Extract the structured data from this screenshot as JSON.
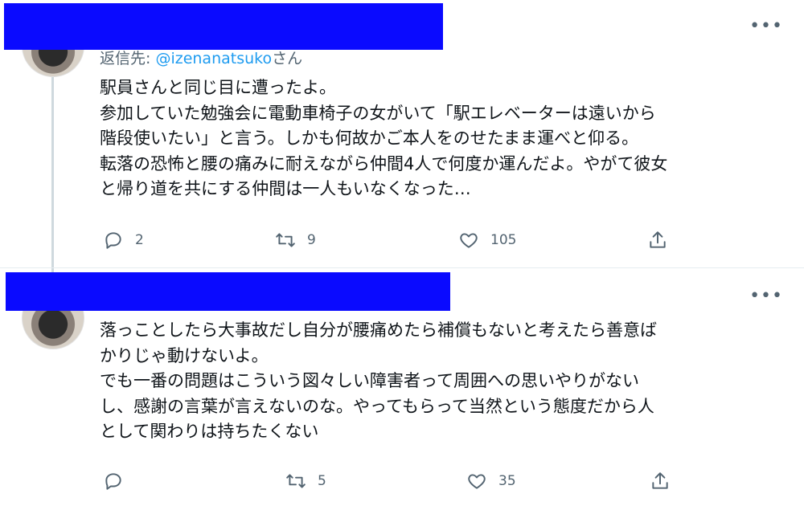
{
  "tweet1": {
    "reply_prefix": "返信先: ",
    "reply_handle": "@izenanatsuko",
    "reply_suffix": "さん",
    "more": "•••",
    "lines": [
      "駅員さんと同じ目に遭ったよ。",
      "参加していた勉強会に電動車椅子の女がいて「駅エレベーターは遠いから",
      "階段使いたい」と言う。しかも何故かご本人をのせたまま運べと仰る。",
      "転落の恐怖と腰の痛みに耐えながら仲間4人で何度か運んだよ。やがて彼女",
      "と帰り道を共にする仲間は一人もいなくなった…"
    ],
    "reply_count": "2",
    "retweet_count": "9",
    "like_count": "105"
  },
  "tweet2": {
    "more": "•••",
    "lines": [
      "落っことしたら大事故だし自分が腰痛めたら補償もないと考えたら善意ば",
      "かりじゃ動けないよ。",
      "でも一番の問題はこういう図々しい障害者って周囲への思いやりがない",
      "し、感謝の言葉が言えないのな。やってもらって当然という態度だから人",
      "として関わりは持ちたくない"
    ],
    "reply_count": "",
    "retweet_count": "5",
    "like_count": "35"
  },
  "icons": [
    "reply-icon",
    "retweet-icon",
    "like-icon",
    "share-icon",
    "more-icon"
  ],
  "colors": {
    "redaction": "#0a0aff",
    "link": "#1d9bf0",
    "muted": "#536471"
  }
}
